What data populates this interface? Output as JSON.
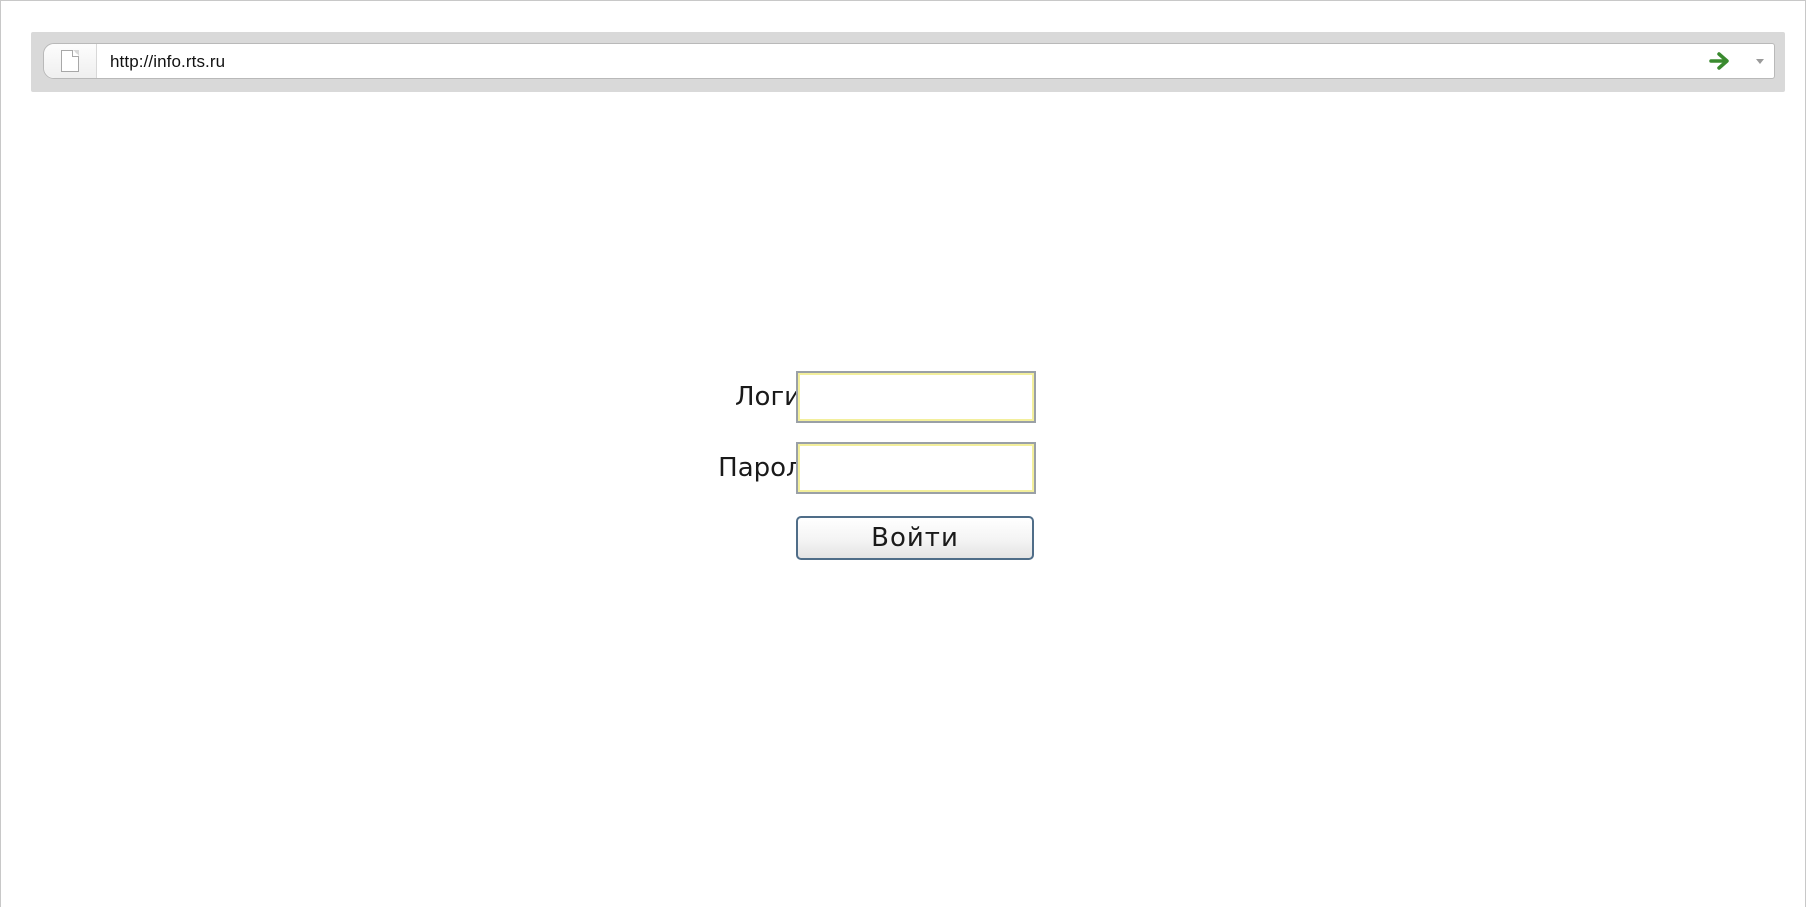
{
  "browser": {
    "address_bar": {
      "url": "http://info.rts.ru",
      "page_icon": "page-icon",
      "go_icon": "green-arrow-right-icon",
      "dropdown_icon": "chevron-down-icon"
    }
  },
  "login_form": {
    "login_label": "Логин",
    "login_value": "",
    "password_label": "Пароль",
    "password_value": "",
    "submit_label": "Войти"
  },
  "colors": {
    "go_arrow": "#3a8a2f",
    "input_highlight": "#f3ef9c",
    "button_border": "#4f6d88"
  }
}
